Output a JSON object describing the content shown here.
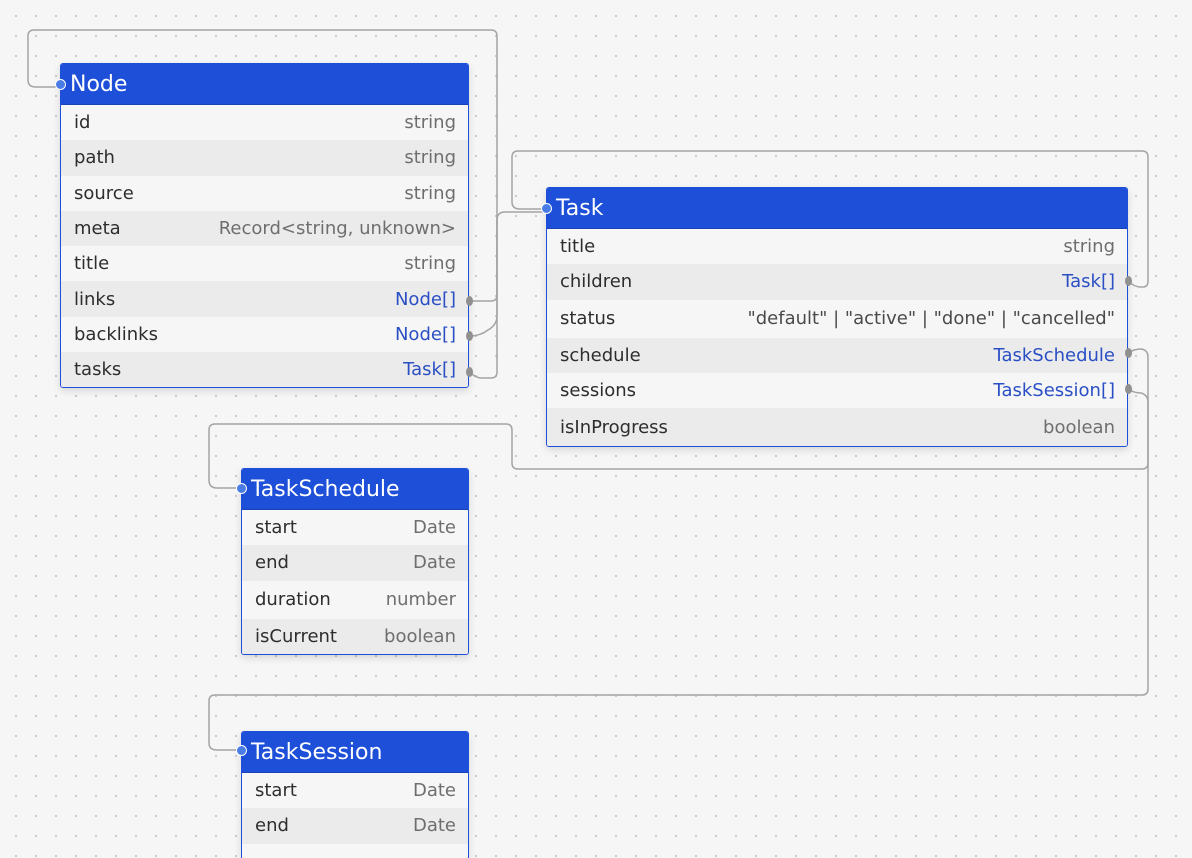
{
  "entities": {
    "node": {
      "name": "Node",
      "fields": [
        {
          "name": "id",
          "type": "string"
        },
        {
          "name": "path",
          "type": "string"
        },
        {
          "name": "source",
          "type": "string"
        },
        {
          "name": "meta",
          "type": "Record<string, unknown>"
        },
        {
          "name": "title",
          "type": "string"
        },
        {
          "name": "links",
          "type": "Node[]"
        },
        {
          "name": "backlinks",
          "type": "Node[]"
        },
        {
          "name": "tasks",
          "type": "Task[]"
        }
      ]
    },
    "task": {
      "name": "Task",
      "fields": [
        {
          "name": "title",
          "type": "string"
        },
        {
          "name": "children",
          "type": "Task[]"
        },
        {
          "name": "status",
          "type": "\"default\" | \"active\" | \"done\" | \"cancelled\""
        },
        {
          "name": "schedule",
          "type": "TaskSchedule"
        },
        {
          "name": "sessions",
          "type": "TaskSession[]"
        },
        {
          "name": "isInProgress",
          "type": "boolean"
        }
      ]
    },
    "task_schedule": {
      "name": "TaskSchedule",
      "fields": [
        {
          "name": "start",
          "type": "Date"
        },
        {
          "name": "end",
          "type": "Date"
        },
        {
          "name": "duration",
          "type": "number"
        },
        {
          "name": "isCurrent",
          "type": "boolean"
        }
      ]
    },
    "task_session": {
      "name": "TaskSession",
      "fields": [
        {
          "name": "start",
          "type": "Date"
        },
        {
          "name": "end",
          "type": "Date"
        }
      ]
    }
  },
  "colors": {
    "header": "#1d4fd8",
    "link_type": "#2a4fc4",
    "edge": "#a4a4a4",
    "port_in": "#4a7ce6",
    "port_out": "#909090"
  }
}
